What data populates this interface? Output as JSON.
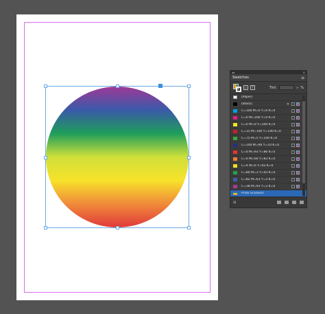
{
  "panel": {
    "title": "Swatches",
    "titlebar_left": "◂◂",
    "titlebar_right": "✕",
    "menu_icon": "menu-icon",
    "tint_label": "Tint:",
    "tint_value": "",
    "tint_unit": "%",
    "tint_arrow": ">",
    "format_icon": "T"
  },
  "swatches": [
    {
      "name": "[Paper]",
      "color": "#ffffff",
      "icons": []
    },
    {
      "name": "[Black]",
      "color": "#000000",
      "icons": [
        "x",
        "none",
        "cmyk"
      ]
    },
    {
      "name": "C=100 M=0 Y=0 K=0",
      "color": "#00a0e0",
      "icons": [
        "none",
        "cmyk"
      ]
    },
    {
      "name": "C=0 M=100 Y=0 K=0",
      "color": "#e0208a",
      "icons": [
        "none",
        "cmyk"
      ]
    },
    {
      "name": "C=0 M=0 Y=100 K=0",
      "color": "#f5e61a",
      "icons": [
        "none",
        "cmyk"
      ]
    },
    {
      "name": "C=15 M=100 Y=100 K=0",
      "color": "#c8202a",
      "icons": [
        "none",
        "cmyk"
      ]
    },
    {
      "name": "C=75 M=5 Y=100 K=0",
      "color": "#3ca53a",
      "icons": [
        "none",
        "cmyk"
      ]
    },
    {
      "name": "C=100 M=90 Y=10 K=0",
      "color": "#28307e",
      "icons": [
        "none",
        "cmyk"
      ]
    },
    {
      "name": "C=0 M=93 Y=86 K=0",
      "color": "#e8332e",
      "icons": [
        "none",
        "cmyk"
      ]
    },
    {
      "name": "C=0 M=60 Y=83 K=0",
      "color": "#f17a34",
      "icons": [
        "none",
        "cmyk"
      ]
    },
    {
      "name": "C=4 M=6 Y=93 K=0",
      "color": "#f2df1e",
      "icons": [
        "none",
        "cmyk"
      ]
    },
    {
      "name": "C=80 M=3 Y=93 K=0",
      "color": "#2aa043",
      "icons": [
        "none",
        "cmyk"
      ]
    },
    {
      "name": "C=82 M=63 Y=3 K=0",
      "color": "#3b62ab",
      "icons": [
        "none",
        "cmyk"
      ]
    },
    {
      "name": "C=38 M=93 Y=3 K=0",
      "color": "#a53a95",
      "icons": [
        "none",
        "cmyk"
      ]
    },
    {
      "name": "Pride Gradient",
      "color": "gradient",
      "icons": [],
      "selected": true
    }
  ],
  "footer": {
    "left_label": "⊞",
    "icons": [
      "show-options-icon",
      "new-group-icon",
      "new-swatch-icon",
      "delete-icon"
    ]
  },
  "colors": {
    "accent": "#2b69b8",
    "selection": "#6aa8e6",
    "margin_guide": "#d86ef0",
    "gradient_stops": [
      "#9e3897",
      "#3a5aa8",
      "#1f9e5a",
      "#cfe03a",
      "#f7e22a",
      "#f08a3a",
      "#e03a3a"
    ]
  }
}
